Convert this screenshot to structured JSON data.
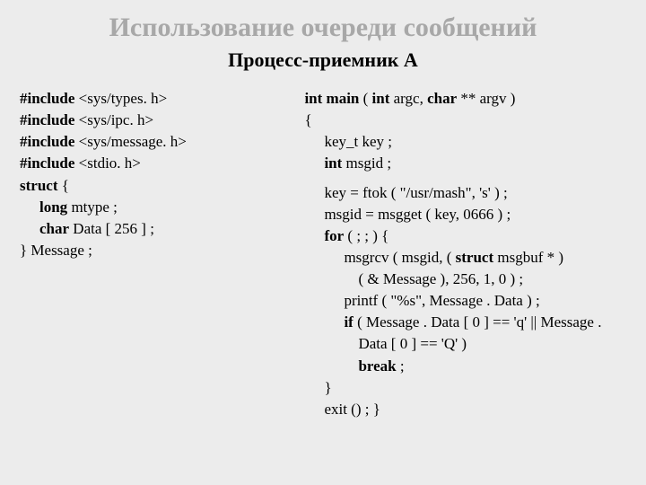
{
  "title": "Использование очереди сообщений",
  "subtitle": "Процесс-приемник А",
  "left": {
    "inc1a": "#include",
    "inc1b": "<sys/types. h>",
    "inc2a": "#include",
    "inc2b": "<sys/ipc. h>",
    "inc3a": "#include",
    "inc3b": "<sys/message. h>",
    "inc4a": "#include",
    "inc4b": "<stdio. h>",
    "struct": "struct",
    "brace": " {",
    "long": "long",
    "mtype": " mtype ;",
    "char": "char",
    "data": " Data [ 256 ] ;",
    "end": "} Message ;"
  },
  "right": {
    "main1": "int main",
    "main2": " ( ",
    "main3": "int",
    "main4": " argc, ",
    "main5": "char",
    "main6": " ** argv )",
    "ob": "{",
    "keydecl": "key_t key ;",
    "int": "int",
    "msgid": " msgid ;",
    "l1": "key = ftok ( \"/usr/mash\", 's' ) ;",
    "l2": "msgid = msgget ( key, 0666 ) ;",
    "for": "for",
    "fortail": " ( ; ; ) {",
    "l4a": "msgrcv ( msgid, ( ",
    "l4b": "struct",
    "l4c": " msgbuf * )",
    "l5": "( & Message ), 256, 1, 0 ) ;",
    "l6": "printf ( \"%s\", Message . Data ) ;",
    "if": "if",
    "l7": " ( Message . Data [ 0 ] == 'q' || Message .",
    "l8": "Data [ 0 ] == 'Q' )",
    "break": "break",
    "semi": " ;",
    "cb": "}",
    "exit": "exit () ; }"
  }
}
